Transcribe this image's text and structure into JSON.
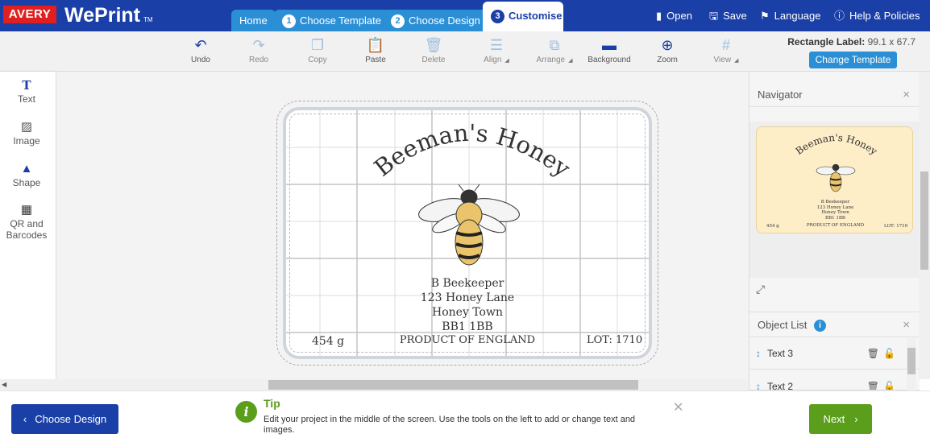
{
  "brand": {
    "avery": "AVERY",
    "weprint": "WePrint",
    "tm": "TM"
  },
  "tabs": [
    {
      "label": "Home",
      "num": ""
    },
    {
      "label": "Choose Template",
      "num": "1"
    },
    {
      "label": "Choose Design",
      "num": "2"
    },
    {
      "label": "Customise",
      "num": "3"
    }
  ],
  "topnav": {
    "open": "Open",
    "save": "Save",
    "language": "Language",
    "help": "Help & Policies"
  },
  "toolbar": {
    "undo": "Undo",
    "redo": "Redo",
    "copy": "Copy",
    "paste": "Paste",
    "delete": "Delete",
    "align": "Align",
    "arrange": "Arrange",
    "background": "Background",
    "zoom": "Zoom",
    "view": "View"
  },
  "template": {
    "name": "Rectangle Label:",
    "size": "99.1 x 67.7",
    "change": "Change Template"
  },
  "sidebar": {
    "text": "Text",
    "image": "Image",
    "shape": "Shape",
    "qr_line1": "QR and",
    "qr_line2": "Barcodes"
  },
  "label": {
    "title": "Beeman's Honey",
    "line1": "B Beekeeper",
    "line2": "123 Honey Lane",
    "line3": "Honey Town",
    "line4": "BB1 1BB",
    "weight": "454 g",
    "origin": "PRODUCT OF ENGLAND",
    "lot": "LOT: 1710"
  },
  "navigator": {
    "title": "Navigator"
  },
  "object_list": {
    "title": "Object List",
    "items": [
      {
        "label": "Text 3"
      },
      {
        "label": "Text 2"
      }
    ]
  },
  "footer": {
    "back": "Choose Design",
    "tip_title": "Tip",
    "tip_text": "Edit your project in the middle of the screen. Use the tools on the left to add or change text and images.",
    "next": "Next"
  },
  "colors": {
    "brand_blue": "#1a3fa6",
    "tab_blue": "#2b8fd6",
    "green": "#5a9e1b",
    "avery_red": "#e02020"
  }
}
